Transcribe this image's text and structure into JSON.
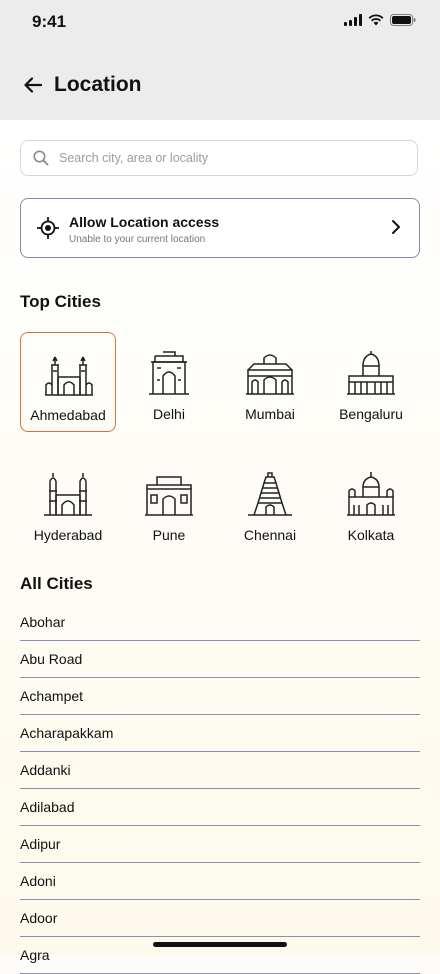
{
  "status_bar": {
    "time": "9:41"
  },
  "header": {
    "title": "Location"
  },
  "search": {
    "placeholder": "Search city, area or locality"
  },
  "allow_location": {
    "title": "Allow Location access",
    "subtitle": "Unable to your current location"
  },
  "top_cities": {
    "heading": "Top Cities",
    "items": [
      {
        "name": "Ahmedabad",
        "selected": true
      },
      {
        "name": "Delhi",
        "selected": false
      },
      {
        "name": "Mumbai",
        "selected": false
      },
      {
        "name": "Bengaluru",
        "selected": false
      },
      {
        "name": "Hyderabad",
        "selected": false
      },
      {
        "name": "Pune",
        "selected": false
      },
      {
        "name": "Chennai",
        "selected": false
      },
      {
        "name": "Kolkata",
        "selected": false
      }
    ]
  },
  "all_cities": {
    "heading": "All Cities",
    "items": [
      "Abohar",
      "Abu Road",
      "Achampet",
      "Acharapakkam",
      "Addanki",
      "Adilabad",
      "Adipur",
      "Adoni",
      "Adoor",
      "Agra"
    ]
  },
  "colors": {
    "accent": "#e0703a",
    "divider": "#8f8cab"
  }
}
